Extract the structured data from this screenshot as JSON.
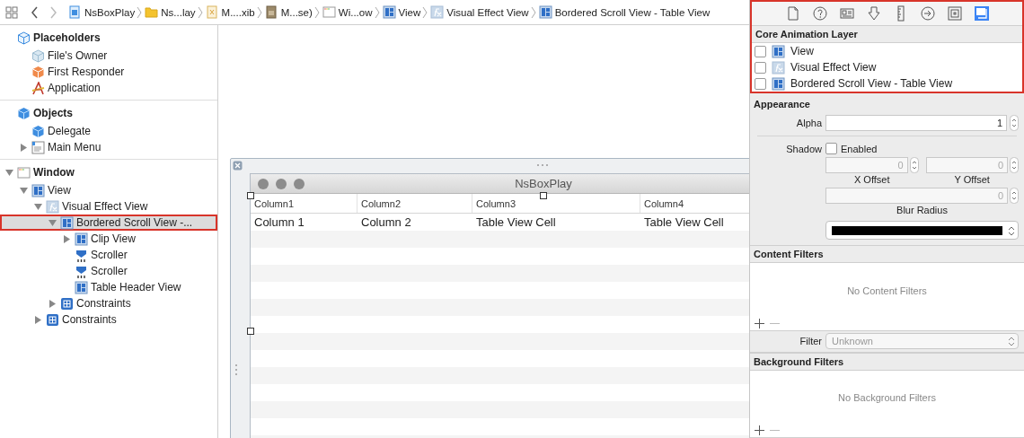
{
  "jump_bar": {
    "crumbs": [
      {
        "label": "NsBoxPlay",
        "kind": "project"
      },
      {
        "label": "Ns...lay",
        "kind": "folder"
      },
      {
        "label": "M....xib",
        "kind": "xib"
      },
      {
        "label": "M...se)",
        "kind": "locale"
      },
      {
        "label": "Wi...ow",
        "kind": "window"
      },
      {
        "label": "View",
        "kind": "view"
      },
      {
        "label": "Visual Effect View",
        "kind": "effect"
      },
      {
        "label": "Bordered Scroll View - Table View",
        "kind": "view"
      }
    ]
  },
  "outline": {
    "sections": [
      {
        "label": "Placeholders",
        "kind": "cube-light",
        "selected": false,
        "children": [
          {
            "label": "File's Owner",
            "kind": "cube-pale",
            "selected": false
          },
          {
            "label": "First Responder",
            "kind": "responder",
            "selected": false
          },
          {
            "label": "Application",
            "kind": "app",
            "selected": false
          }
        ]
      },
      {
        "label": "Objects",
        "kind": "cube",
        "selected": false,
        "children": [
          {
            "label": "Delegate",
            "kind": "cube",
            "selected": false
          },
          {
            "label": "Main Menu",
            "kind": "menu",
            "selected": false,
            "expanded": false
          }
        ]
      },
      {
        "label": "Window",
        "kind": "window",
        "selected": false,
        "expanded": true,
        "children": [
          {
            "label": "View",
            "kind": "view",
            "selected": false,
            "expanded": true,
            "children": [
              {
                "label": "Visual Effect View",
                "kind": "effect",
                "selected": false,
                "expanded": true,
                "children": [
                  {
                    "label": "Bordered Scroll View -...",
                    "kind": "view",
                    "selected": true,
                    "outlined": true,
                    "expanded": true,
                    "children": [
                      {
                        "label": "Clip View",
                        "kind": "view",
                        "selected": false,
                        "expanded": false
                      },
                      {
                        "label": "Scroller",
                        "kind": "scroller",
                        "selected": false
                      },
                      {
                        "label": "Scroller",
                        "kind": "scroller",
                        "selected": false
                      },
                      {
                        "label": "Table Header View",
                        "kind": "view",
                        "selected": false
                      }
                    ]
                  },
                  {
                    "label": "Constraints",
                    "kind": "constraints",
                    "selected": false,
                    "expanded": false
                  }
                ]
              },
              {
                "label": "Constraints",
                "kind": "constraints",
                "selected": false,
                "expanded": false
              }
            ]
          }
        ]
      }
    ]
  },
  "canvas": {
    "window": {
      "title": "NsBoxPlay",
      "columns": [
        {
          "label": "Column1"
        },
        {
          "label": "Column2"
        },
        {
          "label": "Column3"
        },
        {
          "label": "Column4"
        }
      ],
      "rows": [
        [
          "Column 1",
          "Column 2",
          "Table View Cell",
          "Table View Cell"
        ]
      ]
    }
  },
  "inspector": {
    "tabs": [
      {
        "kind": "file",
        "selected": false
      },
      {
        "kind": "help",
        "selected": false
      },
      {
        "kind": "identity",
        "selected": false
      },
      {
        "kind": "attributes",
        "selected": false
      },
      {
        "kind": "size",
        "selected": false
      },
      {
        "kind": "connections",
        "selected": false
      },
      {
        "kind": "bindings",
        "selected": false
      },
      {
        "kind": "effects",
        "selected": true
      }
    ],
    "outlined": true,
    "layer": {
      "title": "Core Animation Layer",
      "rows": [
        {
          "label": "View",
          "kind": "view",
          "checked": false
        },
        {
          "label": "Visual Effect View",
          "kind": "effect",
          "checked": false
        },
        {
          "label": "Bordered Scroll View - Table View",
          "kind": "view",
          "checked": false
        }
      ]
    },
    "appearance": {
      "title": "Appearance",
      "alpha": {
        "label": "Alpha",
        "value": "1"
      },
      "shadow": {
        "label": "Shadow",
        "option": "Enabled",
        "checked": false,
        "x_offset": {
          "value": "0",
          "label": "X Offset"
        },
        "y_offset": {
          "value": "0",
          "label": "Y Offset"
        },
        "blur": {
          "value": "0",
          "label": "Blur Radius"
        }
      }
    },
    "content_filters": {
      "title": "Content Filters",
      "empty_text": "No Content Filters"
    },
    "filter": {
      "label": "Filter",
      "value": "Unknown"
    },
    "background_filters": {
      "title": "Background Filters",
      "empty_text": "No Background Filters"
    }
  }
}
